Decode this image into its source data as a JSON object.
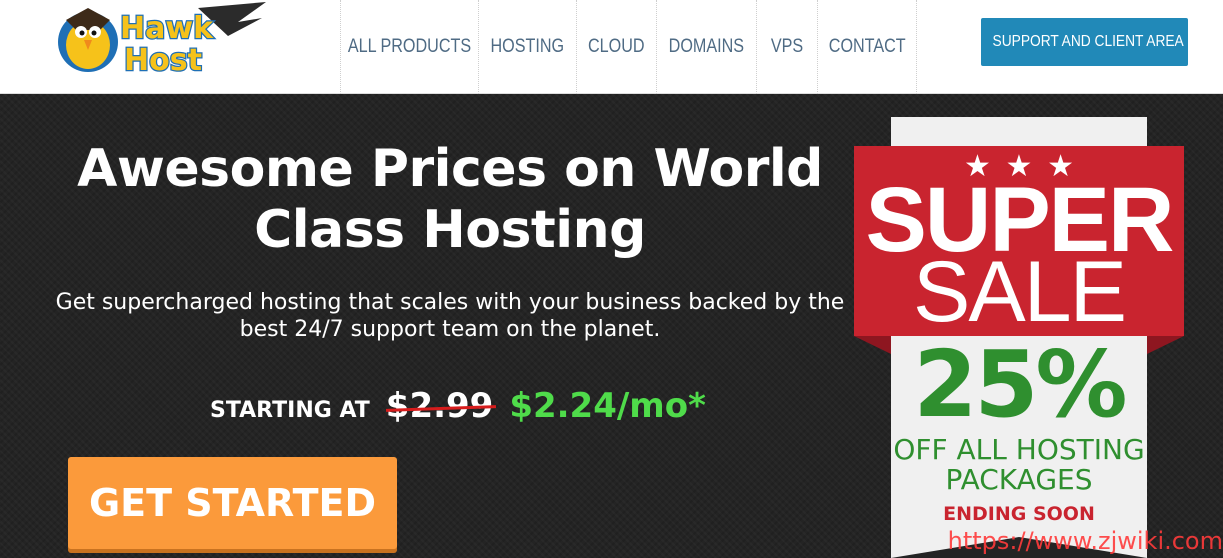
{
  "brand": {
    "name": "Hawk Host",
    "logo_line1": "Hawk",
    "logo_line2": "Host"
  },
  "nav": {
    "items": [
      {
        "label": "ALL PRODUCTS"
      },
      {
        "label": "HOSTING"
      },
      {
        "label": "CLOUD"
      },
      {
        "label": "DOMAINS"
      },
      {
        "label": "VPS"
      },
      {
        "label": "CONTACT"
      }
    ],
    "support_label": "SUPPORT AND CLIENT AREA",
    "support_icon": "lifebuoy-icon"
  },
  "hero": {
    "headline": "Awesome Prices on World Class Hosting",
    "subline": "Get supercharged hosting that scales with your business backed by the best 24/7 support team on the planet.",
    "starting_label": "STARTING AT",
    "old_price": "$2.99",
    "new_price": "$2.24/mo*",
    "cta_label": "GET STARTED"
  },
  "badge": {
    "stars": "★ ★ ★",
    "super": "SUPER",
    "sale": "SALE",
    "percent": "25%",
    "offer_line1": "OFF ALL HOSTING",
    "offer_line2": "PACKAGES",
    "ending": "ENDING SOON"
  },
  "watermark": "https://www.zjwiki.com",
  "colors": {
    "accent_blue": "#2189b8",
    "cta_orange": "#fb9a3b",
    "sale_red": "#c9242f",
    "price_green": "#4fdc4a",
    "badge_green": "#2f8f2f"
  }
}
